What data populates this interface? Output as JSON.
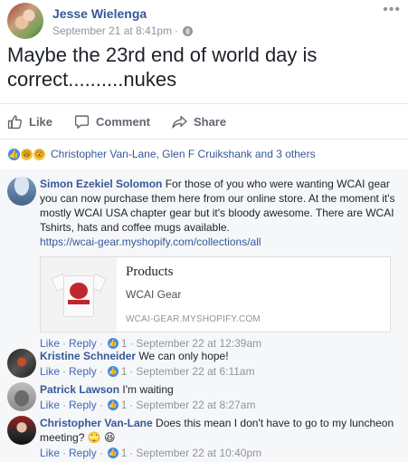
{
  "post": {
    "author": "Jesse Wielenga",
    "timestamp": "September 21 at 8:41pm",
    "separator": "·",
    "more_icon": "more-horizontal-icon",
    "text": "Maybe the 23rd end of world day is correct..........nukes"
  },
  "actions": {
    "like": "Like",
    "comment": "Comment",
    "share": "Share"
  },
  "reactions": {
    "types": [
      "like",
      "haha",
      "wow"
    ],
    "names": "Christopher Van-Lane, Glen F Cruikshank and 3 others"
  },
  "comments": [
    {
      "author": "Simon Ezekiel Solomon",
      "text": "For those of you who were wanting WCAI gear you can now purchase them here from our online store. At the moment it's mostly WCAI USA chapter gear but it's bloody awesome. There are WCAI Tshirts, hats and coffee mugs available.",
      "link": "https://wcai-gear.myshopify.com/collections/all",
      "preview": {
        "title": "Products",
        "subtitle": "WCAI Gear",
        "domain": "WCAI-GEAR.MYSHOPIFY.COM"
      },
      "like_label": "Like",
      "reply_label": "Reply",
      "like_count": "1",
      "time": "September 22 at 12:39am"
    },
    {
      "author": "Kristine Schneider",
      "text": "We can only hope!",
      "like_label": "Like",
      "reply_label": "Reply",
      "like_count": "1",
      "time": "September 22 at 6:11am"
    },
    {
      "author": "Patrick Lawson",
      "text": "I'm waiting",
      "like_label": "Like",
      "reply_label": "Reply",
      "like_count": "1",
      "time": "September 22 at 8:27am"
    },
    {
      "author": "Christopher Van-Lane",
      "text": "Does this mean I don't have to go to my luncheon meeting?",
      "emoji": "🙄 😆",
      "like_label": "Like",
      "reply_label": "Reply",
      "like_count": "1",
      "time": "September 22 at 10:40pm"
    }
  ],
  "colors": {
    "link_blue": "#365899",
    "action_blue": "#4267b2",
    "meta_grey": "#90949c",
    "like_blue": "#3b8af3",
    "comment_bg": "#f6f7f9"
  }
}
